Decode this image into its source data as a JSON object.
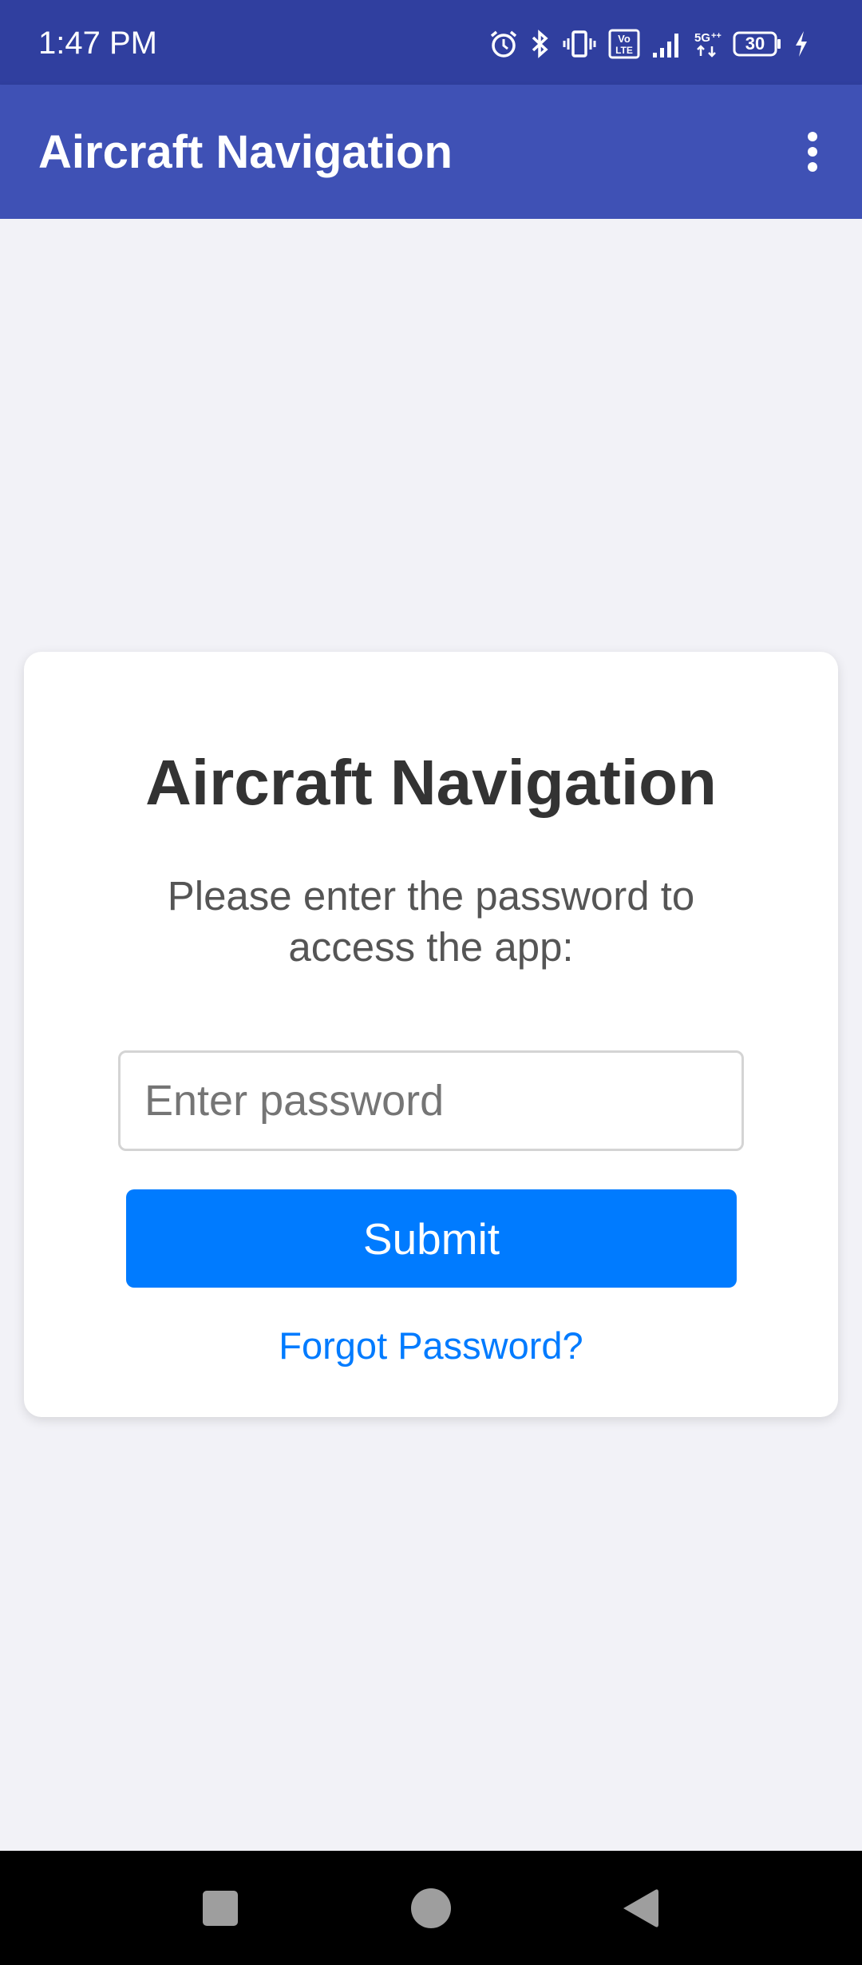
{
  "status_bar": {
    "time": "1:47 PM",
    "battery_level": "30",
    "icons": [
      "alarm-icon",
      "bluetooth-icon",
      "vibrate-icon",
      "volte-icon",
      "signal-icon",
      "5g-icon",
      "battery-icon",
      "charging-icon"
    ]
  },
  "app_bar": {
    "title": "Aircraft Navigation",
    "menu_icon": "more-vert-icon"
  },
  "login_card": {
    "title": "Aircraft Navigation",
    "subtitle": "Please enter the password to access the app:",
    "password_placeholder": "Enter password",
    "password_value": "",
    "submit_label": "Submit",
    "forgot_label": "Forgot Password?"
  },
  "nav_bar": {
    "buttons": [
      "recents-icon",
      "home-icon",
      "back-icon"
    ]
  },
  "colors": {
    "status_bar": "#303f9f",
    "app_bar": "#3f51b5",
    "accent": "#007bff",
    "background": "#f2f2f7"
  }
}
